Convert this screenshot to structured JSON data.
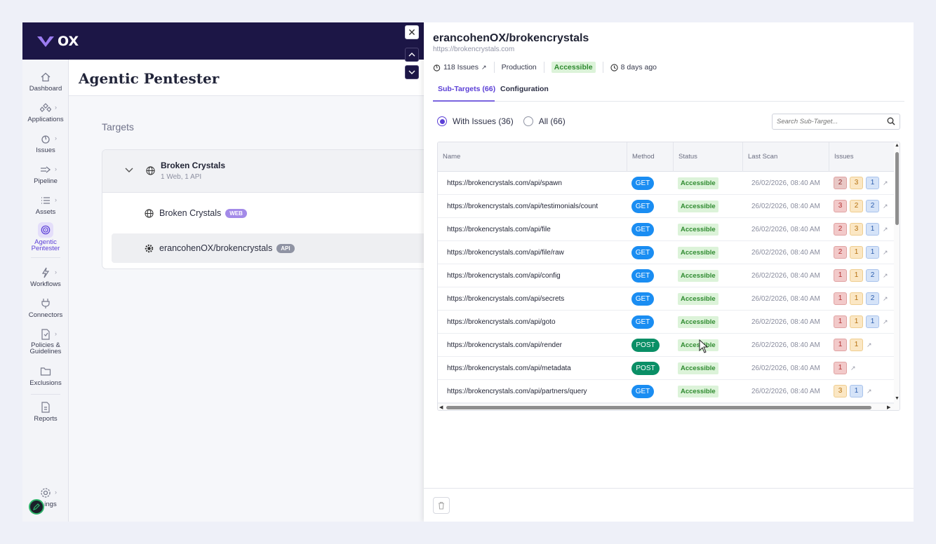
{
  "app": {
    "logo_text": "OX",
    "page_title": "Agentic Pentester"
  },
  "sidebar": {
    "items": [
      {
        "label": "Dashboard",
        "icon": "home-icon"
      },
      {
        "label": "Applications",
        "icon": "apps-icon"
      },
      {
        "label": "Issues",
        "icon": "issues-icon"
      },
      {
        "label": "Pipeline",
        "icon": "pipeline-icon"
      },
      {
        "label": "Assets",
        "icon": "assets-icon"
      },
      {
        "label": "Agentic\nPentester",
        "icon": "target-icon"
      },
      {
        "label": "Workflows",
        "icon": "workflows-icon"
      },
      {
        "label": "Connectors",
        "icon": "plug-icon"
      },
      {
        "label": "Policies &\nGuidelines",
        "icon": "policy-icon"
      },
      {
        "label": "Exclusions",
        "icon": "folder-icon"
      },
      {
        "label": "Reports",
        "icon": "report-icon"
      },
      {
        "label": "ings",
        "icon": "gear-icon"
      }
    ]
  },
  "targets": {
    "label": "Targets",
    "group": {
      "name": "Broken Crystals",
      "sub": "1 Web, 1 API"
    },
    "rows": [
      {
        "name": "Broken Crystals",
        "tag": "WEB"
      },
      {
        "name": "erancohenOX/brokencrystals",
        "tag": "API"
      }
    ]
  },
  "drawer": {
    "title": "erancohenOX/brokencrystals",
    "url": "https://brokencrystals.com",
    "meta": {
      "issues": "118 Issues",
      "env": "Production",
      "status": "Accessible",
      "time": "8 days ago"
    },
    "tabs": [
      {
        "label": "Sub-Targets (66)"
      },
      {
        "label": "Configuration"
      }
    ],
    "filters": {
      "with_issues": "With Issues (36)",
      "all": "All (66)"
    },
    "search_placeholder": "Search Sub-Target...",
    "columns": {
      "name": "Name",
      "method": "Method",
      "status": "Status",
      "last_scan": "Last Scan",
      "issues": "Issues"
    },
    "rows": [
      {
        "name": "https://brokencrystals.com/api/spawn",
        "method": "GET",
        "status": "Accessible",
        "scan": "26/02/2026, 08:40 AM",
        "issues": [
          [
            "c",
            "2"
          ],
          [
            "h",
            "3"
          ],
          [
            "m",
            "1"
          ]
        ]
      },
      {
        "name": "https://brokencrystals.com/api/testimonials/count",
        "method": "GET",
        "status": "Accessible",
        "scan": "26/02/2026, 08:40 AM",
        "issues": [
          [
            "c",
            "3"
          ],
          [
            "h",
            "2"
          ],
          [
            "m",
            "2"
          ]
        ]
      },
      {
        "name": "https://brokencrystals.com/api/file",
        "method": "GET",
        "status": "Accessible",
        "scan": "26/02/2026, 08:40 AM",
        "issues": [
          [
            "c",
            "2"
          ],
          [
            "h",
            "3"
          ],
          [
            "m",
            "1"
          ]
        ]
      },
      {
        "name": "https://brokencrystals.com/api/file/raw",
        "method": "GET",
        "status": "Accessible",
        "scan": "26/02/2026, 08:40 AM",
        "issues": [
          [
            "c",
            "2"
          ],
          [
            "h",
            "1"
          ],
          [
            "m",
            "1"
          ]
        ]
      },
      {
        "name": "https://brokencrystals.com/api/config",
        "method": "GET",
        "status": "Accessible",
        "scan": "26/02/2026, 08:40 AM",
        "issues": [
          [
            "c",
            "1"
          ],
          [
            "h",
            "1"
          ],
          [
            "m",
            "2"
          ]
        ]
      },
      {
        "name": "https://brokencrystals.com/api/secrets",
        "method": "GET",
        "status": "Accessible",
        "scan": "26/02/2026, 08:40 AM",
        "issues": [
          [
            "c",
            "1"
          ],
          [
            "h",
            "1"
          ],
          [
            "m",
            "2"
          ]
        ]
      },
      {
        "name": "https://brokencrystals.com/api/goto",
        "method": "GET",
        "status": "Accessible",
        "scan": "26/02/2026, 08:40 AM",
        "issues": [
          [
            "c",
            "1"
          ],
          [
            "h",
            "1"
          ],
          [
            "m",
            "1"
          ]
        ]
      },
      {
        "name": "https://brokencrystals.com/api/render",
        "method": "POST",
        "status": "Accessible",
        "scan": "26/02/2026, 08:40 AM",
        "issues": [
          [
            "c",
            "1"
          ],
          [
            "h",
            "1"
          ]
        ]
      },
      {
        "name": "https://brokencrystals.com/api/metadata",
        "method": "POST",
        "status": "Accessible",
        "scan": "26/02/2026, 08:40 AM",
        "issues": [
          [
            "c",
            "1"
          ]
        ]
      },
      {
        "name": "https://brokencrystals.com/api/partners/query",
        "method": "GET",
        "status": "Accessible",
        "scan": "26/02/2026, 08:40 AM",
        "issues": [
          [
            "h",
            "3"
          ],
          [
            "m",
            "1"
          ]
        ]
      }
    ]
  }
}
